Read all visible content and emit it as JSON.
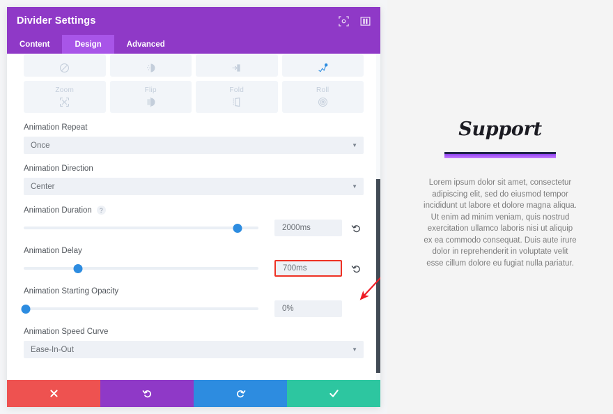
{
  "modal": {
    "title": "Divider Settings",
    "header_icons": [
      {
        "name": "focus-icon"
      },
      {
        "name": "layout-toggle-icon"
      }
    ],
    "tabs": [
      {
        "label": "Content",
        "active": false
      },
      {
        "label": "Design",
        "active": true
      },
      {
        "label": "Advanced",
        "active": false
      }
    ],
    "animation_styles": {
      "row1": [
        {
          "label": "",
          "icon": "no-animation-icon",
          "selected": false
        },
        {
          "label": "",
          "icon": "fade-icon",
          "selected": false
        },
        {
          "label": "",
          "icon": "slide-icon",
          "selected": false
        },
        {
          "label": "",
          "icon": "bounce-icon",
          "selected": true
        }
      ],
      "row2": [
        {
          "label": "Zoom",
          "icon": "zoom-icon",
          "selected": false
        },
        {
          "label": "Flip",
          "icon": "flip-icon",
          "selected": false
        },
        {
          "label": "Fold",
          "icon": "fold-icon",
          "selected": false
        },
        {
          "label": "Roll",
          "icon": "roll-icon",
          "selected": false
        }
      ]
    },
    "fields": {
      "animation_repeat": {
        "label": "Animation Repeat",
        "value": "Once"
      },
      "animation_direction": {
        "label": "Animation Direction",
        "value": "Center"
      },
      "animation_duration": {
        "label": "Animation Duration",
        "value": "2000ms",
        "slider_percent": 91,
        "help": "?",
        "highlighted": false
      },
      "animation_delay": {
        "label": "Animation Delay",
        "value": "700ms",
        "slider_percent": 23,
        "highlighted": true
      },
      "animation_starting_opacity": {
        "label": "Animation Starting Opacity",
        "value": "0%",
        "slider_percent": 1,
        "highlighted": false
      },
      "animation_speed_curve": {
        "label": "Animation Speed Curve",
        "value": "Ease-In-Out"
      }
    },
    "actions": [
      {
        "name": "cancel-button",
        "icon": "close-icon"
      },
      {
        "name": "undo-button",
        "icon": "undo-icon"
      },
      {
        "name": "redo-button",
        "icon": "redo-icon"
      },
      {
        "name": "save-button",
        "icon": "check-icon"
      }
    ],
    "colors": {
      "header": "#8f39c7",
      "tab_active": "#a855e8",
      "accent_blue": "#2d8ce0",
      "cancel": "#ee5250",
      "save": "#2dc6a0",
      "highlight": "#ee3124"
    }
  },
  "preview": {
    "title": "Support",
    "body": "Lorem ipsum dolor sit amet, consectetur adipiscing elit, sed do eiusmod tempor incididunt ut labore et dolore magna aliqua. Ut enim ad minim veniam, quis nostrud exercitation ullamco laboris nisi ut aliquip ex ea commodo consequat. Duis aute irure dolor in reprehenderit in voluptate velit esse cillum dolore eu fugiat nulla pariatur."
  }
}
